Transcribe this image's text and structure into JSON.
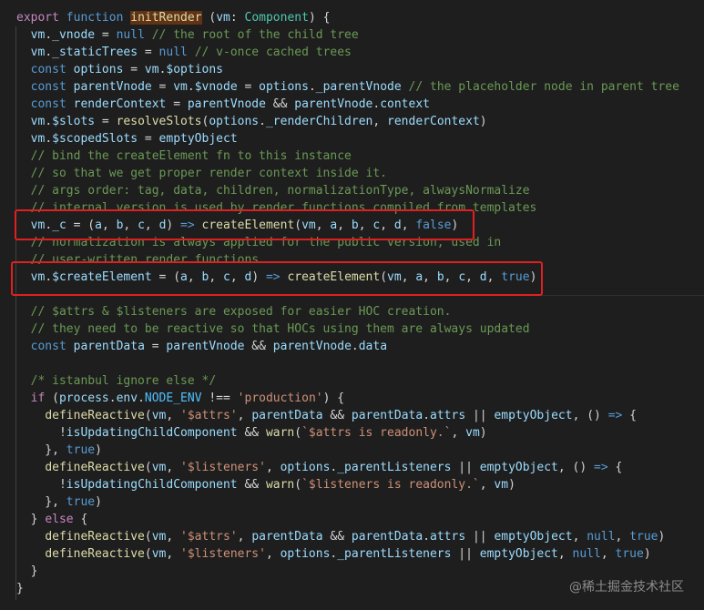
{
  "editor": {
    "lines": [
      "export function initRender (vm: Component) {",
      "  vm._vnode = null // the root of the child tree",
      "  vm._staticTrees = null // v-once cached trees",
      "  const options = vm.$options",
      "  const parentVnode = vm.$vnode = options._parentVnode // the placeholder node in parent tree",
      "  const renderContext = parentVnode && parentVnode.context",
      "  vm.$slots = resolveSlots(options._renderChildren, renderContext)",
      "  vm.$scopedSlots = emptyObject",
      "  // bind the createElement fn to this instance",
      "  // so that we get proper render context inside it.",
      "  // args order: tag, data, children, normalizationType, alwaysNormalize",
      "  // internal version is used by render functions compiled from templates",
      "  vm._c = (a, b, c, d) => createElement(vm, a, b, c, d, false)",
      "  // normalization is always applied for the public version, used in",
      "  // user-written render functions.",
      "  vm.$createElement = (a, b, c, d) => createElement(vm, a, b, c, d, true)",
      "",
      "  // $attrs & $listeners are exposed for easier HOC creation.",
      "  // they need to be reactive so that HOCs using them are always updated",
      "  const parentData = parentVnode && parentVnode.data",
      "",
      "  /* istanbul ignore else */",
      "  if (process.env.NODE_ENV !== 'production') {",
      "    defineReactive(vm, '$attrs', parentData && parentData.attrs || emptyObject, () => {",
      "      !isUpdatingChildComponent && warn(`$attrs is readonly.`, vm)",
      "    }, true)",
      "    defineReactive(vm, '$listeners', options._parentListeners || emptyObject, () => {",
      "      !isUpdatingChildComponent && warn(`$listeners is readonly.`, vm)",
      "    }, true)",
      "  } else {",
      "    defineReactive(vm, '$attrs', parentData && parentData.attrs || emptyObject, null, true)",
      "    defineReactive(vm, '$listeners', options._parentListeners || emptyObject, null, true)",
      "  }",
      "}"
    ],
    "colors": {
      "background": "#1e1e1e",
      "highlight_box": "#e02020"
    }
  },
  "watermark": "@稀土掘金技术社区"
}
